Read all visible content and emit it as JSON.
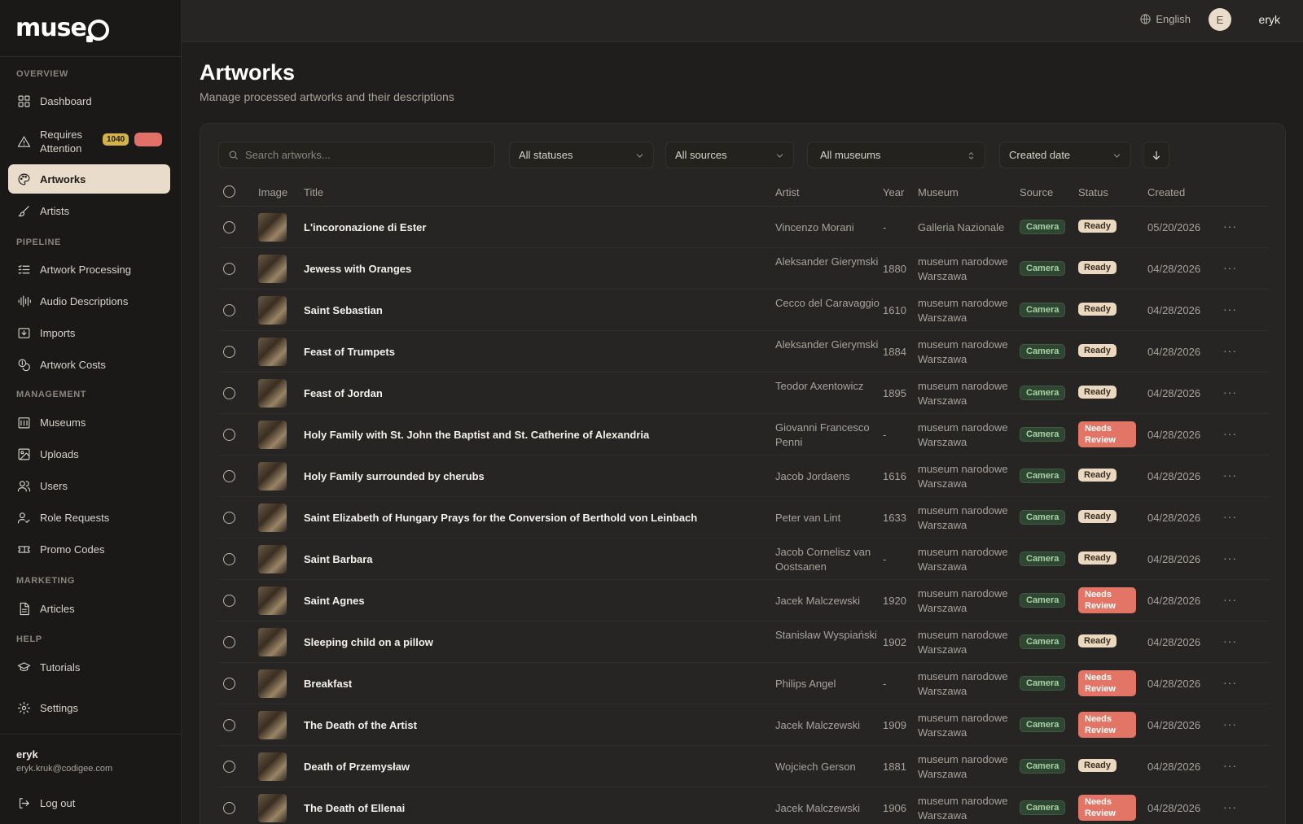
{
  "sidebar": {
    "logo": "museo",
    "sections": {
      "overview": "OVERVIEW",
      "pipeline": "PIPELINE",
      "management": "MANAGEMENT",
      "marketing": "MARKETING",
      "help": "HELP"
    },
    "items": {
      "dashboard": "Dashboard",
      "requires_attention": "Requires Attention",
      "requires_attention_count": "1040",
      "artworks": "Artworks",
      "artists": "Artists",
      "artwork_processing": "Artwork Processing",
      "audio_descriptions": "Audio Descriptions",
      "imports": "Imports",
      "artwork_costs": "Artwork Costs",
      "museums": "Museums",
      "uploads": "Uploads",
      "users": "Users",
      "role_requests": "Role Requests",
      "promo_codes": "Promo Codes",
      "articles": "Articles",
      "tutorials": "Tutorials",
      "settings": "Settings"
    },
    "user": {
      "name": "eryk",
      "email": "eryk.kruk@codigee.com",
      "logout": "Log out"
    }
  },
  "topbar": {
    "language": "English",
    "avatar_initial": "E",
    "user": "eryk"
  },
  "page": {
    "title": "Artworks",
    "subtitle": "Manage processed artworks and their descriptions"
  },
  "filters": {
    "search_placeholder": "Search artworks...",
    "status": "All statuses",
    "source": "All sources",
    "museum": "All museums",
    "sort": "Created date"
  },
  "table": {
    "headers": {
      "image": "Image",
      "title": "Title",
      "artist": "Artist",
      "year": "Year",
      "museum": "Museum",
      "source": "Source",
      "status": "Status",
      "created": "Created"
    },
    "rows": [
      {
        "title": "L'incoronazione di Ester",
        "artist": "Vincenzo Morani",
        "year": "-",
        "museum": "Galleria Nazionale",
        "source": "Camera",
        "status": "Ready",
        "created": "05/20/2026"
      },
      {
        "title": "Jewess with Oranges",
        "artist": "Aleksander Gierymski",
        "year": "1880",
        "museum": "museum narodowe Warszawa",
        "source": "Camera",
        "status": "Ready",
        "created": "04/28/2026"
      },
      {
        "title": "Saint Sebastian",
        "artist": "Cecco del Caravaggio",
        "year": "1610",
        "museum": "museum narodowe Warszawa",
        "source": "Camera",
        "status": "Ready",
        "created": "04/28/2026"
      },
      {
        "title": "Feast of Trumpets",
        "artist": "Aleksander Gierymski",
        "year": "1884",
        "museum": "museum narodowe Warszawa",
        "source": "Camera",
        "status": "Ready",
        "created": "04/28/2026"
      },
      {
        "title": "Feast of Jordan",
        "artist": "Teodor Axentowicz",
        "year": "1895",
        "museum": "museum narodowe Warszawa",
        "source": "Camera",
        "status": "Ready",
        "created": "04/28/2026"
      },
      {
        "title": "Holy Family with St. John the Baptist and St. Catherine of Alexandria",
        "artist": "Giovanni Francesco Penni",
        "year": "-",
        "museum": "museum narodowe Warszawa",
        "source": "Camera",
        "status": "Needs Review",
        "created": "04/28/2026"
      },
      {
        "title": "Holy Family surrounded by cherubs",
        "artist": "Jacob Jordaens",
        "year": "1616",
        "museum": "museum narodowe Warszawa",
        "source": "Camera",
        "status": "Ready",
        "created": "04/28/2026"
      },
      {
        "title": "Saint Elizabeth of Hungary Prays for the Conversion of Berthold von Leinbach",
        "artist": "Peter van Lint",
        "year": "1633",
        "museum": "museum narodowe Warszawa",
        "source": "Camera",
        "status": "Ready",
        "created": "04/28/2026"
      },
      {
        "title": "Saint Barbara",
        "artist": "Jacob Cornelisz van Oostsanen",
        "year": "-",
        "museum": "museum narodowe Warszawa",
        "source": "Camera",
        "status": "Ready",
        "created": "04/28/2026"
      },
      {
        "title": "Saint Agnes",
        "artist": "Jacek Malczewski",
        "year": "1920",
        "museum": "museum narodowe Warszawa",
        "source": "Camera",
        "status": "Needs Review",
        "created": "04/28/2026"
      },
      {
        "title": "Sleeping child on a pillow",
        "artist": "Stanisław Wyspiański",
        "year": "1902",
        "museum": "museum narodowe Warszawa",
        "source": "Camera",
        "status": "Ready",
        "created": "04/28/2026"
      },
      {
        "title": "Breakfast",
        "artist": "Philips Angel",
        "year": "-",
        "museum": "museum narodowe Warszawa",
        "source": "Camera",
        "status": "Needs Review",
        "created": "04/28/2026"
      },
      {
        "title": "The Death of the Artist",
        "artist": "Jacek Malczewski",
        "year": "1909",
        "museum": "museum narodowe Warszawa",
        "source": "Camera",
        "status": "Needs Review",
        "created": "04/28/2026"
      },
      {
        "title": "Death of Przemysław",
        "artist": "Wojciech Gerson",
        "year": "1881",
        "museum": "museum narodowe Warszawa",
        "source": "Camera",
        "status": "Ready",
        "created": "04/28/2026"
      },
      {
        "title": "The Death of Ellenai",
        "artist": "Jacek Malczewski",
        "year": "1906",
        "museum": "museum narodowe Warszawa",
        "source": "Camera",
        "status": "Needs Review",
        "created": "04/28/2026"
      }
    ]
  },
  "colors": {
    "accent": "#e9dccb",
    "ready": "#ead8c0",
    "needs_review": "#e27565",
    "camera": "#2f4632",
    "attention": "#d4b24a"
  }
}
